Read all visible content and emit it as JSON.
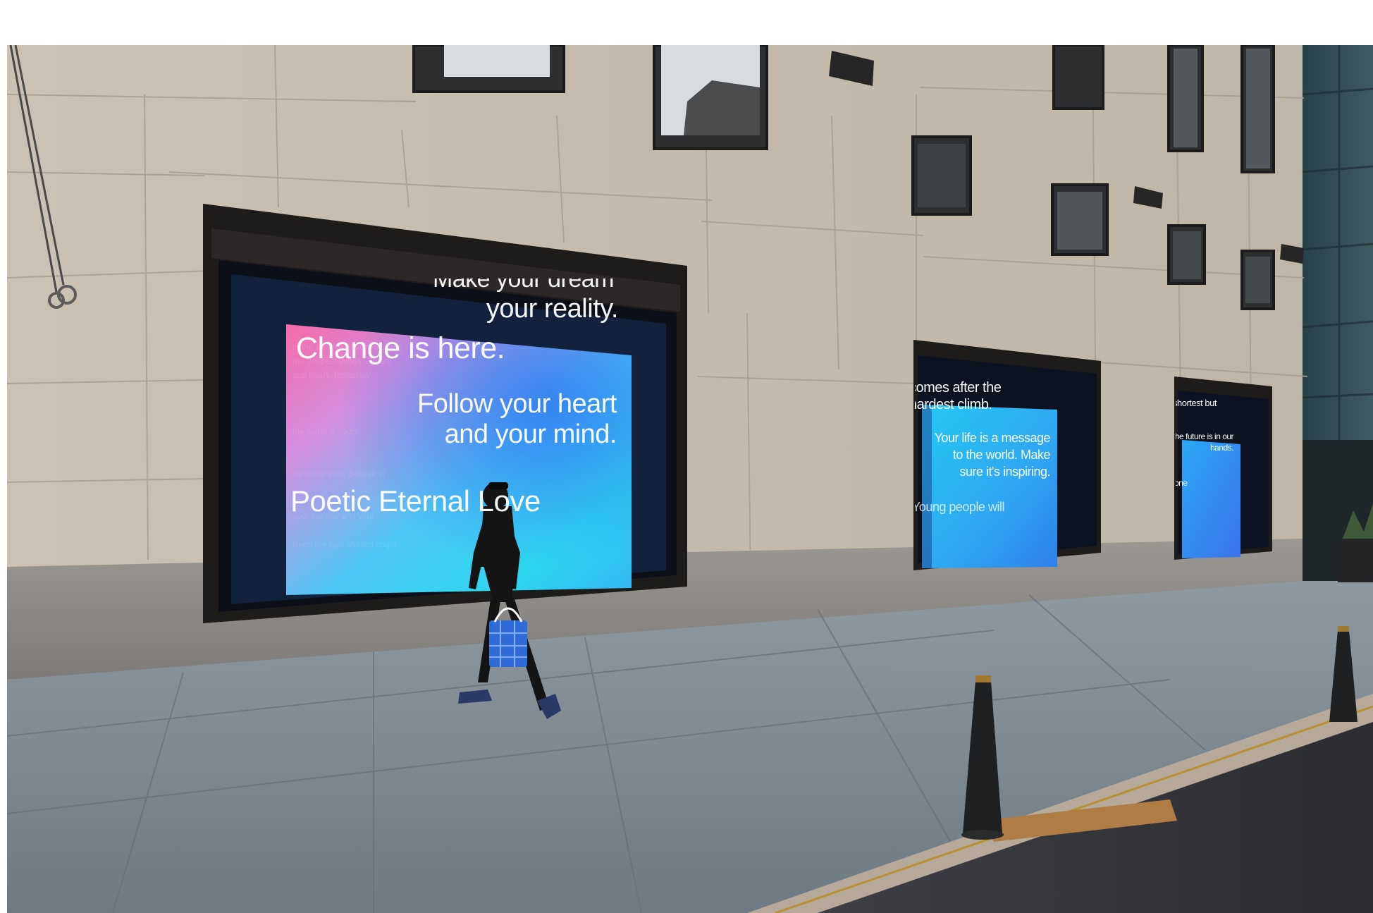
{
  "screens": {
    "main": {
      "line_top": "Make your dream",
      "line_reality": "your reality.",
      "line_change": "Change is here.",
      "line_follow_1": "Follow your heart",
      "line_follow_2": "and your mind.",
      "line_bottom": "Poetic Eternal Love"
    },
    "middle": {
      "line_1": "comes after the",
      "line_2": "hardest climb.",
      "line_3": "Your life is a message",
      "line_4": "to the world. Make",
      "line_5": "sure it's inspiring.",
      "line_6": "Young people will"
    },
    "right": {
      "line_1": "shortest but",
      "line_2": "the future is in our",
      "line_3": "hands.",
      "line_4": "one"
    }
  },
  "colors": {
    "stone": "#c8beb0",
    "granite": "#8d8a86",
    "sidewalk": "#7f8b93",
    "screen_pink": "#f06fae",
    "screen_cyan": "#2fd6f2",
    "screen_blue": "#2a8ff0"
  }
}
